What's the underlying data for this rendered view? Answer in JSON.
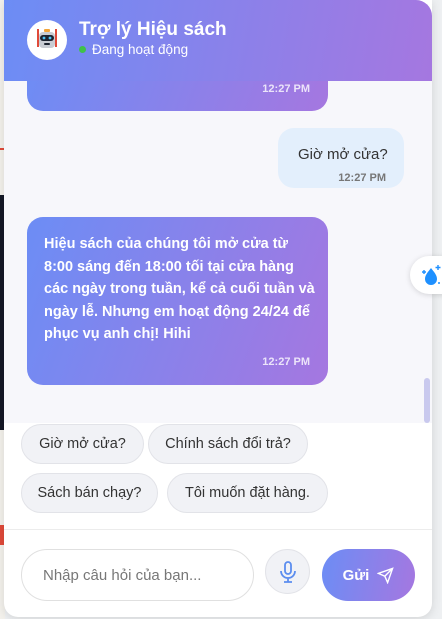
{
  "header": {
    "title": "Trợ lý Hiệu sách",
    "status": "Đang hoạt động",
    "status_color": "#3fc24a"
  },
  "messages": [
    {
      "role": "bot",
      "text": "",
      "time": "12:27 PM"
    },
    {
      "role": "user",
      "text": "Giờ mở cửa?",
      "time": "12:27 PM"
    },
    {
      "role": "bot",
      "text": "Hiệu sách của chúng tôi mở cửa từ 8:00 sáng đến 18:00 tối tại cửa hàng các ngày trong tuần, kể cả cuối tuần và ngày lễ. Nhưng em hoạt động 24/24 để phục vụ anh chị! Hihi",
      "time": "12:27 PM"
    }
  ],
  "quick_replies": [
    "Giờ mở cửa?",
    "Chính sách đổi trả?",
    "Sách bán chạy?",
    "Tôi muốn đặt hàng."
  ],
  "composer": {
    "placeholder": "Nhập câu hỏi của bạn...",
    "send_label": "Gửi"
  },
  "icons": {
    "avatar": "robot-icon",
    "mic": "microphone-icon",
    "send": "paper-plane-icon",
    "float": "water-drop-sparkle-icon"
  },
  "colors": {
    "gradient_start": "#6c8df5",
    "gradient_end": "#a577e0",
    "user_bubble": "#e3effc"
  }
}
